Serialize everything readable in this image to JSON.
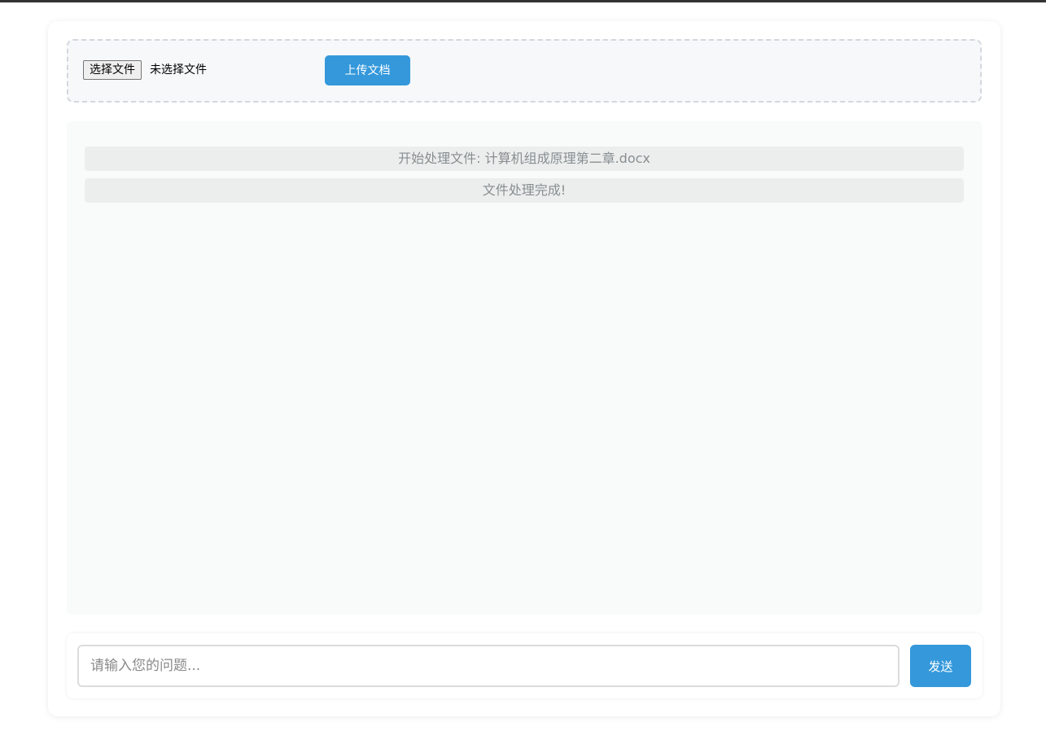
{
  "upload": {
    "choose_file_label": "选择文件",
    "file_status": "未选择文件",
    "upload_button_label": "上传文档"
  },
  "log": {
    "messages": [
      "开始处理文件: 计算机组成原理第二章.docx",
      "文件处理完成!"
    ]
  },
  "chat_input": {
    "placeholder": "请输入您的问题...",
    "value": "",
    "send_label": "发送"
  },
  "colors": {
    "accent": "#3498db",
    "log_text": "#888e90",
    "log_bg": "#eceeee"
  }
}
